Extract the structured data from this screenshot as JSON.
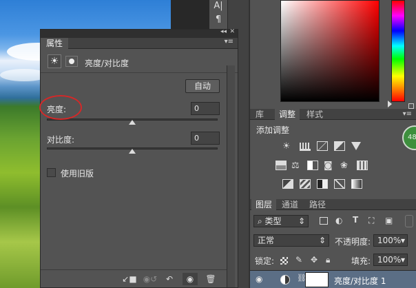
{
  "properties": {
    "tab_title": "属性",
    "layer_type": "亮度/对比度",
    "auto_label": "自动",
    "brightness_label": "亮度:",
    "brightness_value": "0",
    "contrast_label": "对比度:",
    "contrast_value": "0",
    "legacy_label": "使用旧版",
    "legacy_checked": false,
    "brightness_slider": 0,
    "contrast_slider": 0
  },
  "adjustments": {
    "tabs": [
      "库",
      "调整",
      "样式"
    ],
    "active_tab": "调整",
    "heading": "添加调整"
  },
  "layers": {
    "tabs": [
      "图层",
      "通道",
      "路径"
    ],
    "active_tab": "图层",
    "filter_kind": "类型",
    "blend_mode": "正常",
    "opacity_label": "不透明度:",
    "opacity_value": "100%",
    "lock_label": "锁定:",
    "fill_label": "填充:",
    "fill_value": "100%",
    "layer_name": "亮度/对比度 1"
  },
  "side_badge": "48",
  "colors": {
    "highlight_circle": "#d42828",
    "hue_top": "#ff0000"
  }
}
